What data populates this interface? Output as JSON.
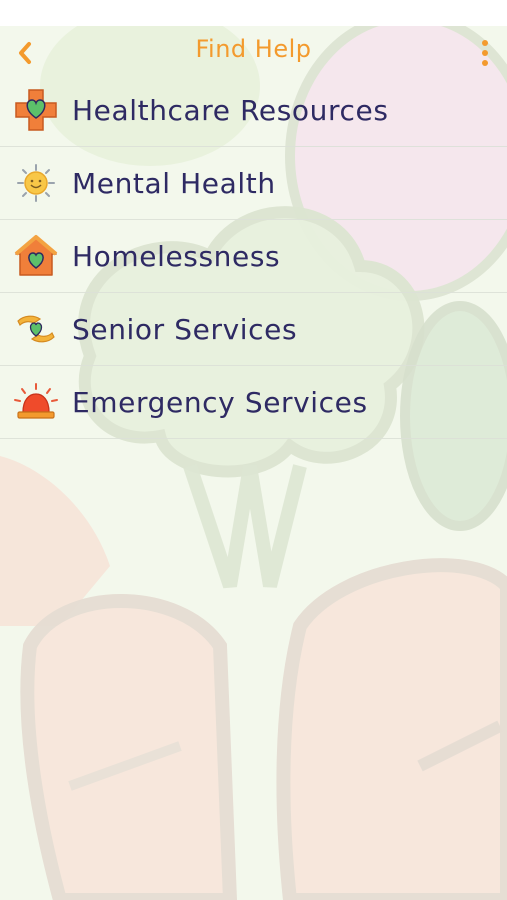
{
  "header": {
    "title": "Find Help",
    "back_icon": "chevron-left-icon",
    "menu_icon": "vertical-dots-icon"
  },
  "colors": {
    "accent": "#f39a2d",
    "text": "#2e2a63",
    "background": "#f3f8ec"
  },
  "menu": {
    "items": [
      {
        "label": "Healthcare Resources",
        "icon": "medical-cross-heart-icon"
      },
      {
        "label": "Mental Health",
        "icon": "smiling-sun-icon"
      },
      {
        "label": "Homelessness",
        "icon": "house-heart-icon"
      },
      {
        "label": "Senior Services",
        "icon": "hands-heart-icon"
      },
      {
        "label": "Emergency Services",
        "icon": "siren-icon"
      }
    ]
  }
}
